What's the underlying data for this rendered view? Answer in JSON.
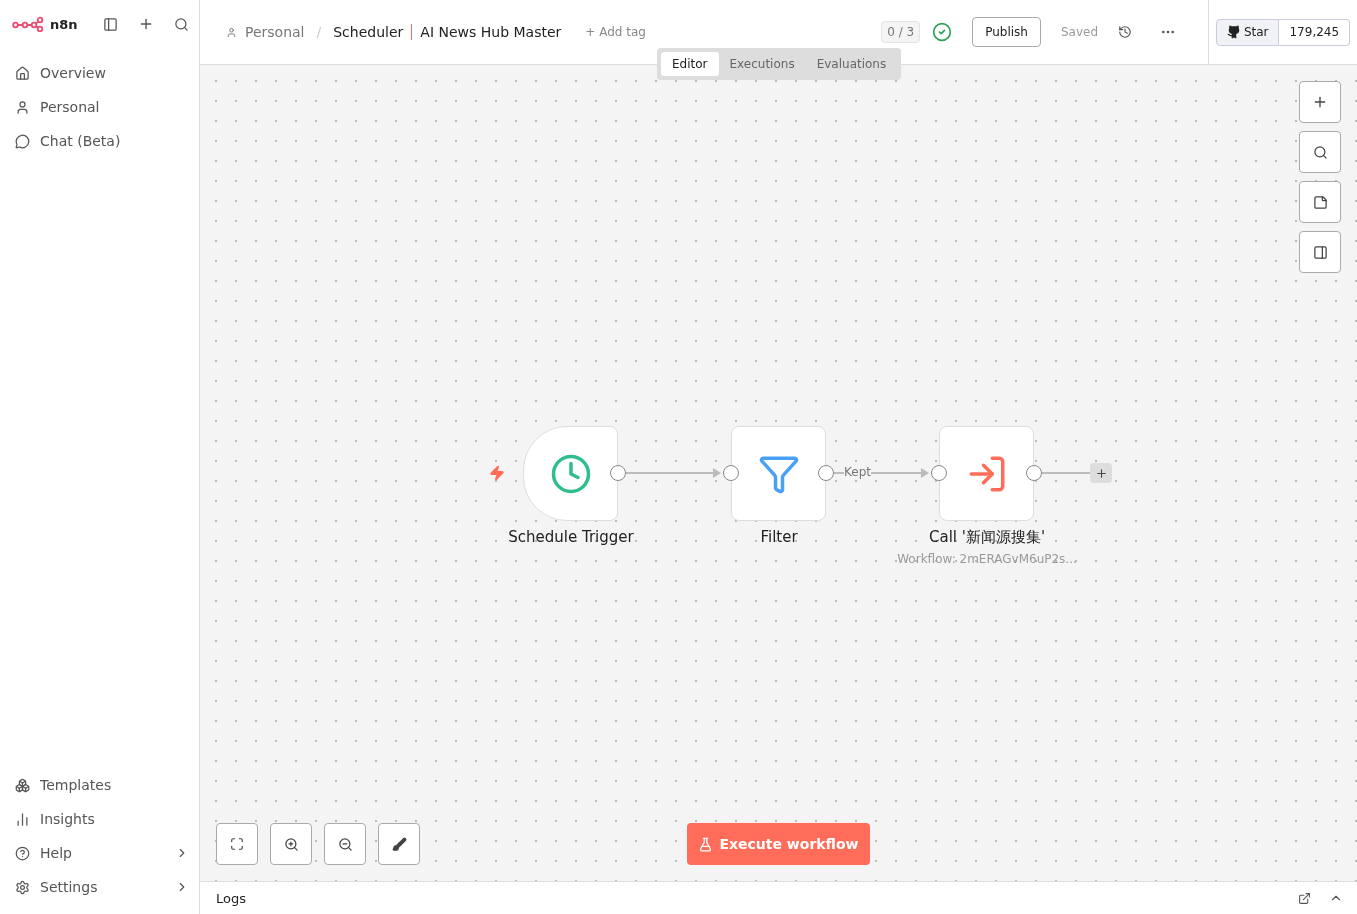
{
  "sidebar": {
    "logo": "n8n",
    "top_items": [
      {
        "label": "Overview",
        "has_submenu": false
      },
      {
        "label": "Personal",
        "has_submenu": false
      },
      {
        "label": "Chat (Beta)",
        "has_submenu": false
      }
    ],
    "bottom_items": [
      {
        "label": "Templates",
        "has_submenu": false
      },
      {
        "label": "Insights",
        "has_submenu": false
      },
      {
        "label": "Help",
        "has_submenu": true
      },
      {
        "label": "Settings",
        "has_submenu": true
      }
    ]
  },
  "header": {
    "project": "Personal",
    "separator": "/",
    "folder": "Scheduler",
    "title": "AI News Hub Master",
    "add_tag": "+ Add tag",
    "counter": "0 / 3",
    "publish": "Publish",
    "status": "Saved",
    "github_star": "Star",
    "github_count": "179,245"
  },
  "tabs": [
    {
      "label": "Editor",
      "selected": true
    },
    {
      "label": "Executions",
      "selected": false
    },
    {
      "label": "Evaluations",
      "selected": false
    }
  ],
  "nodes": [
    {
      "kind": "schedule",
      "label": "Schedule Trigger",
      "trigger": true
    },
    {
      "kind": "filter",
      "label": "Filter",
      "trigger": false,
      "output_label": "Kept"
    },
    {
      "kind": "workflow",
      "label": "Call '新闻源搜集'",
      "subtitle": "Workflow: 2mERAGvM6uP2s...",
      "trigger": false
    }
  ],
  "execute_button": "Execute workflow",
  "logs": {
    "title": "Logs"
  }
}
